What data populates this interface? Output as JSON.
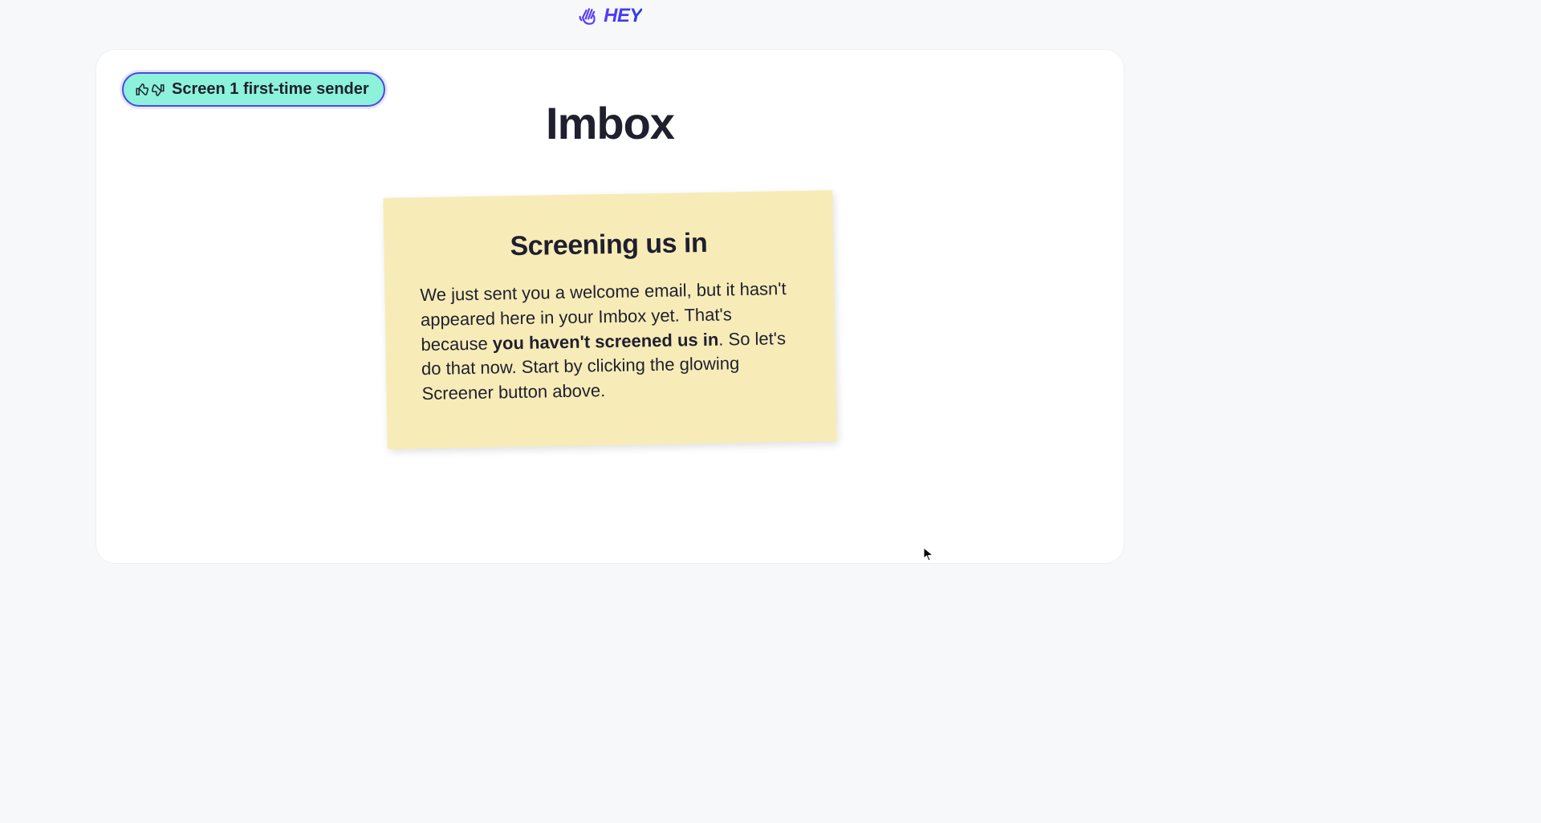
{
  "logo": {
    "text": "HEY"
  },
  "screener": {
    "label": "Screen 1 first-time sender"
  },
  "page": {
    "title": "Imbox"
  },
  "note": {
    "title": "Screening us in",
    "body_before": "We just sent you a welcome email, but it hasn't appeared here in your Imbox yet. That's because ",
    "body_bold": "you haven't screened us in",
    "body_after": ". So let's do that now. Start by clicking the glowing Screener button above."
  }
}
